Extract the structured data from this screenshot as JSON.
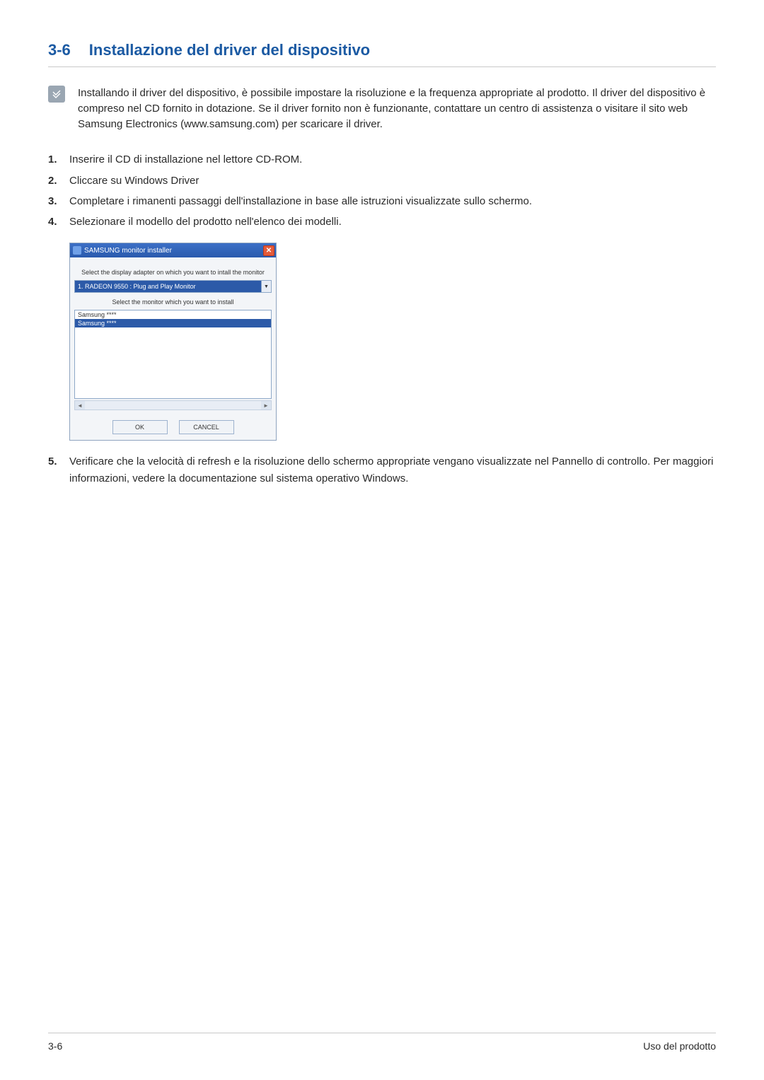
{
  "heading": {
    "number": "3-6",
    "title": "Installazione del driver del dispositivo"
  },
  "note": {
    "text": "Installando il driver del dispositivo, è possibile impostare la risoluzione e la frequenza appropriate al prodotto. Il driver del dispositivo è compreso nel CD fornito in dotazione. Se il driver fornito non è funzionante, contattare un centro di assistenza o visitare il sito web Samsung Electronics (www.samsung.com) per scaricare il driver."
  },
  "steps": [
    {
      "n": "1.",
      "t": "Inserire il CD di installazione nel lettore CD-ROM."
    },
    {
      "n": "2.",
      "t": "Cliccare su Windows Driver"
    },
    {
      "n": "3.",
      "t": "Completare i rimanenti passaggi dell'installazione in base alle istruzioni visualizzate sullo schermo."
    },
    {
      "n": "4.",
      "t": "Selezionare il modello del prodotto nell'elenco dei modelli."
    }
  ],
  "dialog": {
    "title": "SAMSUNG monitor installer",
    "label_adapter": "Select the display adapter on which you want to intall the monitor",
    "adapter_selected": "1. RADEON 9550 : Plug and Play Monitor",
    "label_monitor": "Select the monitor which you want to install",
    "monitors": [
      "Samsung ****",
      "Samsung ****"
    ],
    "ok": "OK",
    "cancel": "CANCEL"
  },
  "step5": {
    "n": "5.",
    "t": "Verificare che la velocità di refresh e la risoluzione dello schermo appropriate vengano visualizzate nel Pannello di controllo. Per maggiori informazioni, vedere la documentazione sul sistema operativo Windows."
  },
  "footer": {
    "left": "3-6",
    "right": "Uso del prodotto"
  }
}
